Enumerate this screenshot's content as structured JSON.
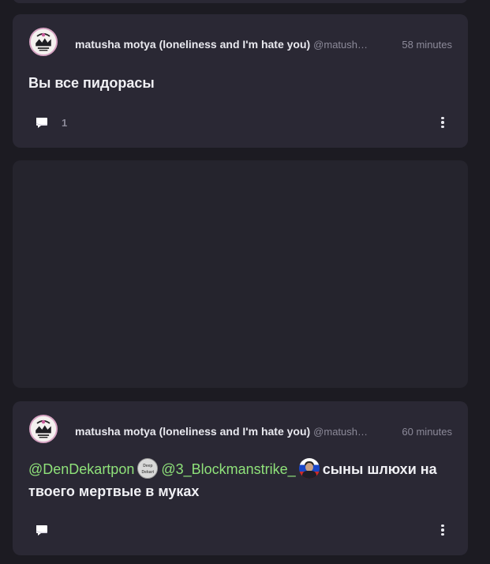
{
  "posts": [
    {
      "author": "matusha motya (loneliness and I'm hate you)",
      "handle": "@matusha...",
      "time": "58 minutes",
      "text": "Вы все пидорасы",
      "comment_count": "1"
    },
    {
      "author": "matusha motya (loneliness and I'm hate you)",
      "handle": "@matusha...",
      "time": "60 minutes",
      "mention1": "@DenDekartpon",
      "mention2": "@3_Blockmanstrike_",
      "text": "сыны шлюхи на твоего мертвые в муках",
      "comment_count": ""
    }
  ],
  "icons": {
    "comment": "comment-icon",
    "more": "more-vertical-icon"
  },
  "colors": {
    "background": "#1c1b22",
    "card": "#2a2834",
    "mention": "#8fe27a",
    "muted": "#8c8a99"
  }
}
